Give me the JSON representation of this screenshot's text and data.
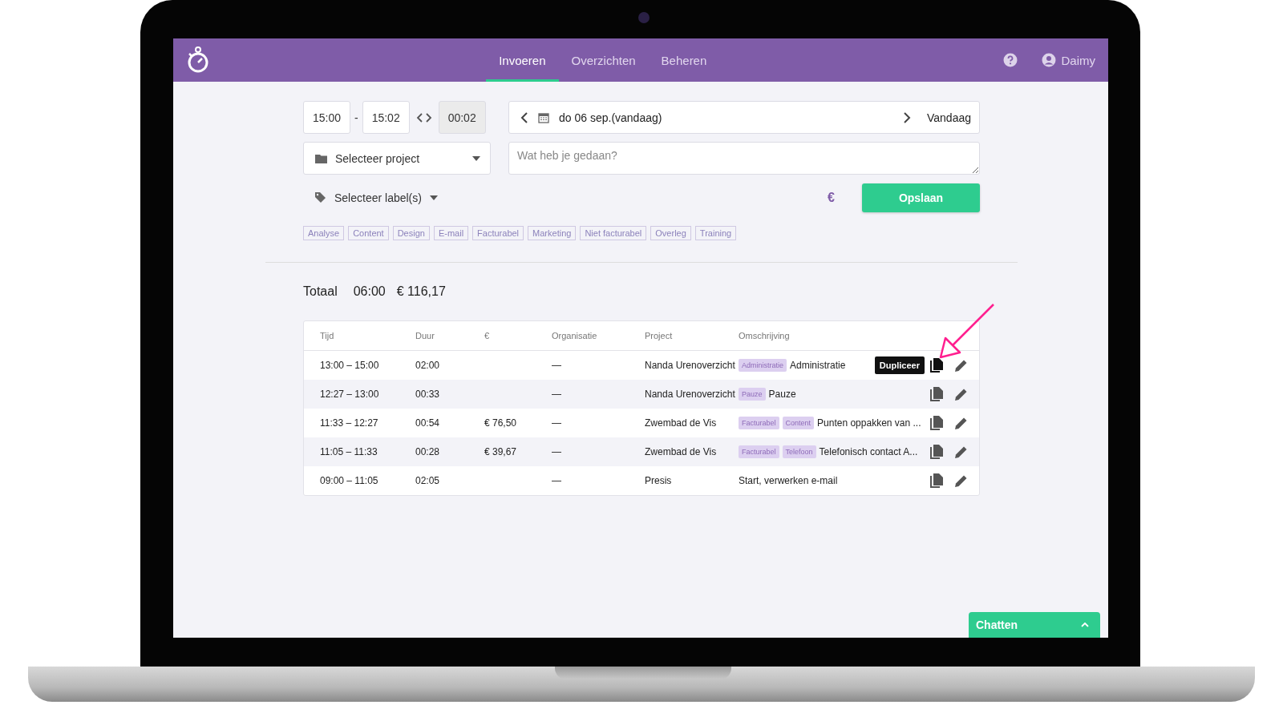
{
  "header": {
    "tabs": [
      {
        "label": "Invoeren",
        "selected": true
      },
      {
        "label": "Overzichten",
        "selected": false
      },
      {
        "label": "Beheren",
        "selected": false
      }
    ],
    "user": "Daimy"
  },
  "form": {
    "start_time": "15:00",
    "separator": "-",
    "end_time": "15:02",
    "duration": "00:02",
    "date": "do 06 sep.(vandaag)",
    "today_button": "Vandaag",
    "project_select": "Selecteer project",
    "description": {
      "placeholder": "Wat heb je gedaan?"
    },
    "label_select": "Selecteer label(s)",
    "currency": "€",
    "save_button": "Opslaan",
    "labels": [
      "Analyse",
      "Content",
      "Design",
      "E-mail",
      "Facturabel",
      "Marketing",
      "Niet facturabel",
      "Overleg",
      "Training"
    ]
  },
  "summary": {
    "label": "Totaal",
    "duration": "06:00",
    "amount": "€ 116,17"
  },
  "table": {
    "columns": [
      "Tijd",
      "Duur",
      "€",
      "Organisatie",
      "Project",
      "Omschrijving"
    ],
    "rows": [
      {
        "time": "13:00 – 15:00",
        "duration": "02:00",
        "organisation": "—",
        "project": "Nanda Urenoverzicht",
        "tags": [
          "Administratie"
        ],
        "description": "Administratie",
        "tooltip": "Dupliceer"
      },
      {
        "time": "12:27 – 13:00",
        "duration": "00:33",
        "organisation": "—",
        "project": "Nanda Urenoverzicht",
        "tags": [
          "Pauze"
        ],
        "description": "Pauze"
      },
      {
        "time": "11:33 – 12:27",
        "duration": "00:54",
        "amount": "€ 76,50",
        "organisation": "—",
        "project": "Zwembad de Vis",
        "tags": [
          "Facturabel",
          "Content"
        ],
        "description": "Punten oppakken van ..."
      },
      {
        "time": "11:05 – 11:33",
        "duration": "00:28",
        "amount": "€ 39,67",
        "organisation": "—",
        "project": "Zwembad de Vis",
        "tags": [
          "Facturabel",
          "Telefoon"
        ],
        "description": "Telefonisch contact A..."
      },
      {
        "time": "09:00 – 11:05",
        "duration": "02:05",
        "organisation": "—",
        "project": "Presis",
        "tags": [],
        "description": "Start, verwerken e-mail"
      }
    ]
  },
  "chat": {
    "label": "Chatten"
  }
}
